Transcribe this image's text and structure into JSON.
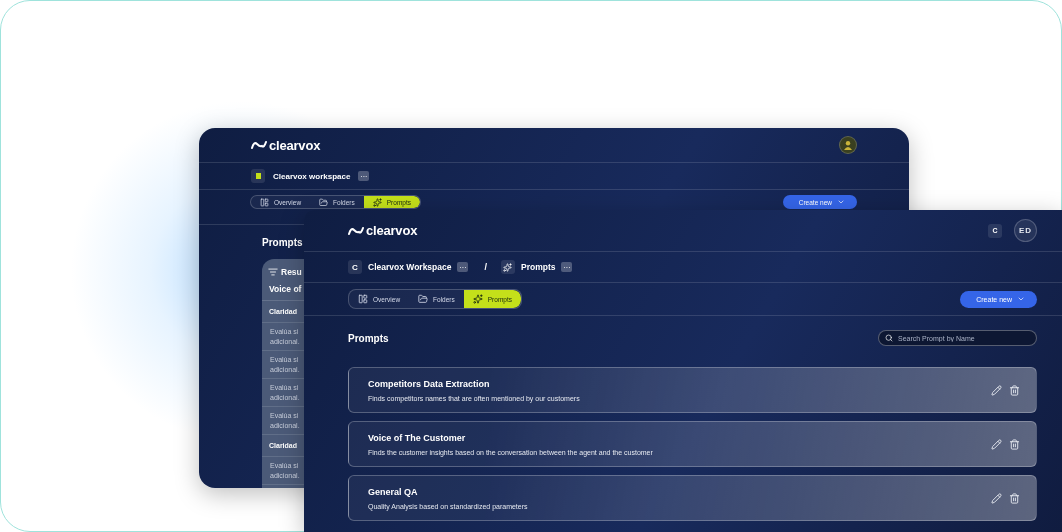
{
  "back_window": {
    "logo": "clearvox",
    "workspace": {
      "name": "Clearvox workspace",
      "more": "···"
    },
    "tabs": [
      {
        "label": "Overview",
        "selected": false
      },
      {
        "label": "Folders",
        "selected": false
      },
      {
        "label": "Prompts",
        "selected": true
      }
    ],
    "create_button": "Create new",
    "section_title": "Prompts",
    "results_panel": {
      "title": "Resu",
      "subtitle": "Voice of",
      "rows": [
        {
          "kind": "group",
          "lines": [
            "Claridad"
          ]
        },
        {
          "kind": "item",
          "lines": [
            "Evalúa si",
            "adicional."
          ]
        },
        {
          "kind": "item",
          "lines": [
            "Evalúa si",
            "adicional."
          ]
        },
        {
          "kind": "item",
          "lines": [
            "Evalúa si",
            "adicional."
          ]
        },
        {
          "kind": "item",
          "lines": [
            "Evalúa si",
            "adicional."
          ]
        },
        {
          "kind": "group",
          "lines": [
            "Claridad"
          ]
        },
        {
          "kind": "item",
          "lines": [
            "Evalúa si",
            "adicional."
          ]
        }
      ]
    }
  },
  "front_window": {
    "logo": "clearvox",
    "org_badge": "C",
    "avatar": "ED",
    "breadcrumb": [
      {
        "badge": "C",
        "label": "Clearvox Workspace",
        "more": "···"
      },
      {
        "separator": "/",
        "label": "Prompts",
        "more": "···"
      }
    ],
    "tabs": [
      {
        "label": "Overview",
        "selected": false
      },
      {
        "label": "Folders",
        "selected": false
      },
      {
        "label": "Prompts",
        "selected": true
      }
    ],
    "create_button": "Create new",
    "section_title": "Prompts",
    "search": {
      "placeholder": "Search Prompt by Name"
    },
    "prompts": [
      {
        "title": "Competitors Data Extraction",
        "description": "Finds competitors names that are often mentioned by our customers"
      },
      {
        "title": "Voice of The Customer",
        "description": "Finds the customer insights based on the conversation between the agent and the customer"
      },
      {
        "title": "General QA",
        "description": "Quality Analysis based on standardized parameters"
      }
    ]
  }
}
